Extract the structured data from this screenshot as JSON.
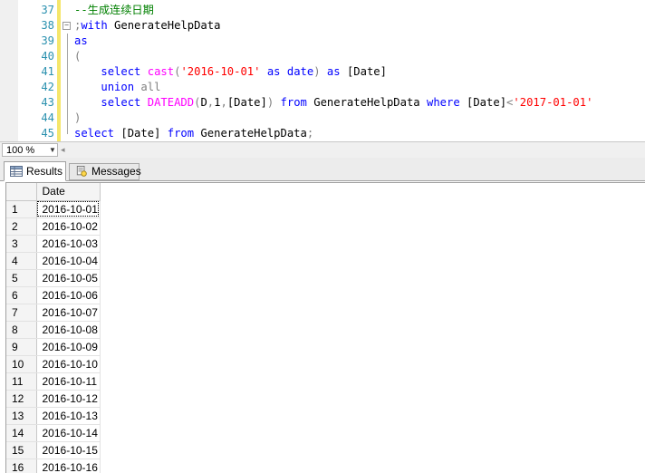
{
  "editor": {
    "lines": [
      {
        "n": "37",
        "tokens": [
          {
            "t": "--生成连续日期",
            "c": "cm"
          }
        ]
      },
      {
        "n": "38",
        "fold": "−",
        "tokens": [
          {
            "t": ";",
            "c": "gray"
          },
          {
            "t": "with",
            "c": "kw"
          },
          {
            "t": " GenerateHelpData",
            "c": ""
          }
        ]
      },
      {
        "n": "39",
        "tokens": [
          {
            "t": "as",
            "c": "kw"
          }
        ]
      },
      {
        "n": "40",
        "tokens": [
          {
            "t": "(",
            "c": "gray"
          }
        ]
      },
      {
        "n": "41",
        "tokens": [
          {
            "t": "    ",
            "c": ""
          },
          {
            "t": "select",
            "c": "kw"
          },
          {
            "t": " ",
            "c": ""
          },
          {
            "t": "cast",
            "c": "fn"
          },
          {
            "t": "(",
            "c": "gray"
          },
          {
            "t": "'2016-10-01'",
            "c": "str"
          },
          {
            "t": " ",
            "c": ""
          },
          {
            "t": "as",
            "c": "kw"
          },
          {
            "t": " ",
            "c": ""
          },
          {
            "t": "date",
            "c": "kw"
          },
          {
            "t": ")",
            "c": "gray"
          },
          {
            "t": " ",
            "c": ""
          },
          {
            "t": "as",
            "c": "kw"
          },
          {
            "t": " [Date]",
            "c": ""
          }
        ]
      },
      {
        "n": "42",
        "tokens": [
          {
            "t": "    ",
            "c": ""
          },
          {
            "t": "union",
            "c": "kw"
          },
          {
            "t": " ",
            "c": ""
          },
          {
            "t": "all",
            "c": "gray"
          }
        ]
      },
      {
        "n": "43",
        "tokens": [
          {
            "t": "    ",
            "c": ""
          },
          {
            "t": "select",
            "c": "kw"
          },
          {
            "t": " ",
            "c": ""
          },
          {
            "t": "DATEADD",
            "c": "fn"
          },
          {
            "t": "(",
            "c": "gray"
          },
          {
            "t": "D",
            "c": ""
          },
          {
            "t": ",",
            "c": "gray"
          },
          {
            "t": "1",
            "c": ""
          },
          {
            "t": ",",
            "c": "gray"
          },
          {
            "t": "[Date]",
            "c": ""
          },
          {
            "t": ")",
            "c": "gray"
          },
          {
            "t": " ",
            "c": ""
          },
          {
            "t": "from",
            "c": "kw"
          },
          {
            "t": " GenerateHelpData ",
            "c": ""
          },
          {
            "t": "where",
            "c": "kw"
          },
          {
            "t": " [Date]",
            "c": ""
          },
          {
            "t": "<",
            "c": "gray"
          },
          {
            "t": "'2017-01-01'",
            "c": "str"
          }
        ]
      },
      {
        "n": "44",
        "tokens": [
          {
            "t": ")",
            "c": "gray"
          }
        ]
      },
      {
        "n": "45",
        "tokens": [
          {
            "t": "select",
            "c": "kw"
          },
          {
            "t": " [Date] ",
            "c": ""
          },
          {
            "t": "from",
            "c": "kw"
          },
          {
            "t": " GenerateHelpData",
            "c": ""
          },
          {
            "t": ";",
            "c": "gray"
          }
        ]
      }
    ]
  },
  "zoom": {
    "value": "100 %"
  },
  "tabs": {
    "results": "Results",
    "messages": "Messages"
  },
  "grid": {
    "column_header": "Date",
    "rows": [
      {
        "n": "1",
        "date": "2016-10-01"
      },
      {
        "n": "2",
        "date": "2016-10-02"
      },
      {
        "n": "3",
        "date": "2016-10-03"
      },
      {
        "n": "4",
        "date": "2016-10-04"
      },
      {
        "n": "5",
        "date": "2016-10-05"
      },
      {
        "n": "6",
        "date": "2016-10-06"
      },
      {
        "n": "7",
        "date": "2016-10-07"
      },
      {
        "n": "8",
        "date": "2016-10-08"
      },
      {
        "n": "9",
        "date": "2016-10-09"
      },
      {
        "n": "10",
        "date": "2016-10-10"
      },
      {
        "n": "11",
        "date": "2016-10-11"
      },
      {
        "n": "12",
        "date": "2016-10-12"
      },
      {
        "n": "13",
        "date": "2016-10-13"
      },
      {
        "n": "14",
        "date": "2016-10-14"
      },
      {
        "n": "15",
        "date": "2016-10-15"
      },
      {
        "n": "16",
        "date": "2016-10-16"
      }
    ]
  },
  "colors": {
    "keyword": "#0000ff",
    "function": "#ff00ff",
    "string": "#ff0000",
    "comment": "#008000",
    "line_number": "#2b91af"
  }
}
